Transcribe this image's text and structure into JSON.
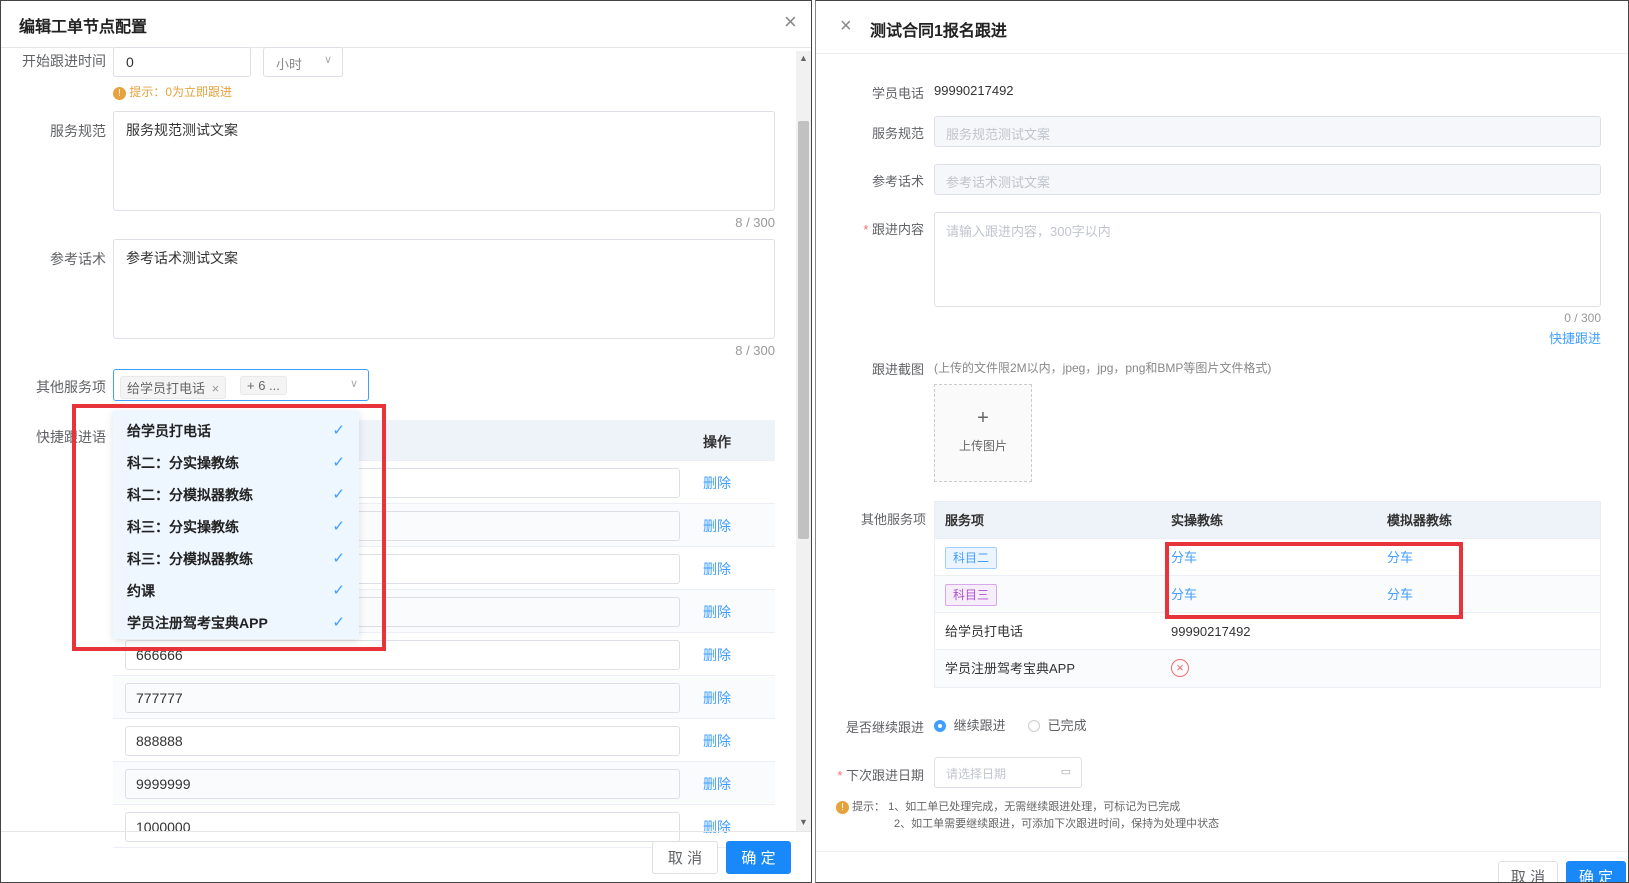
{
  "left": {
    "title": "编辑工单节点配置",
    "start_time": {
      "label": "开始跟进时间",
      "value": "0",
      "unit": "小时",
      "hint": "提示：0为立即跟进"
    },
    "service_norm": {
      "label": "服务规范",
      "value": "服务规范测试文案",
      "count": "8 / 300"
    },
    "reference_script": {
      "label": "参考话术",
      "value": "参考话术测试文案",
      "count": "8 / 300"
    },
    "other_services": {
      "label": "其他服务项",
      "tag": "给学员打电话",
      "more": "+ 6 ..."
    },
    "quick_phrase": {
      "label": "快捷跟进语",
      "op_header": "操作",
      "delete": "删除"
    },
    "dropdown_items": [
      "给学员打电话",
      "科二：分实操教练",
      "科二：分模拟器教练",
      "科三：分实操教练",
      "科三：分模拟器教练",
      "约课",
      "学员注册驾考宝典APP"
    ],
    "rows": [
      "",
      "",
      "",
      "",
      "666666",
      "777777",
      "888888",
      "9999999",
      "1000000"
    ],
    "cancel": "取 消",
    "ok": "确 定"
  },
  "right": {
    "title": "测试合同1报名跟进",
    "phone_label": "学员电话",
    "phone_value": "99990217492",
    "norm_label": "服务规范",
    "norm_value": "服务规范测试文案",
    "script_label": "参考话术",
    "script_value": "参考话术测试文案",
    "content_label": "跟进内容",
    "content_placeholder": "请输入跟进内容，300字以内",
    "content_count": "0 / 300",
    "quick_link": "快捷跟进",
    "screenshot_label": "跟进截图",
    "screenshot_hint": "(上传的文件限2M以内，jpeg，jpg，png和BMP等图片文件格式)",
    "upload_label": "上传图片",
    "services_label": "其他服务项",
    "table_headers": [
      "服务项",
      "实操教练",
      "模拟器教练"
    ],
    "table_rows": [
      {
        "item": "科目二",
        "a": "分车",
        "b": "分车"
      },
      {
        "item": "科目三",
        "a": "分车",
        "b": "分车"
      },
      {
        "item": "给学员打电话",
        "a": "99990217492",
        "b": ""
      },
      {
        "item": "学员注册驾考宝典APP",
        "a": "",
        "b": ""
      }
    ],
    "continue_label": "是否继续跟进",
    "opt_continue": "继续跟进",
    "opt_done": "已完成",
    "next_date_label": "下次跟进日期",
    "date_placeholder": "请选择日期",
    "tip_prefix": "提示：",
    "tip1": "1、如工单已处理完成，无需继续跟进处理，可标记为已完成",
    "tip2": "2、如工单需要继续跟进，可添加下次跟进时间，保持为处理中状态",
    "cancel": "取 消",
    "ok": "确 定"
  },
  "colors": {
    "primary": "#1989fa",
    "highlight": "#e8333a",
    "warning": "#e6a23c"
  }
}
